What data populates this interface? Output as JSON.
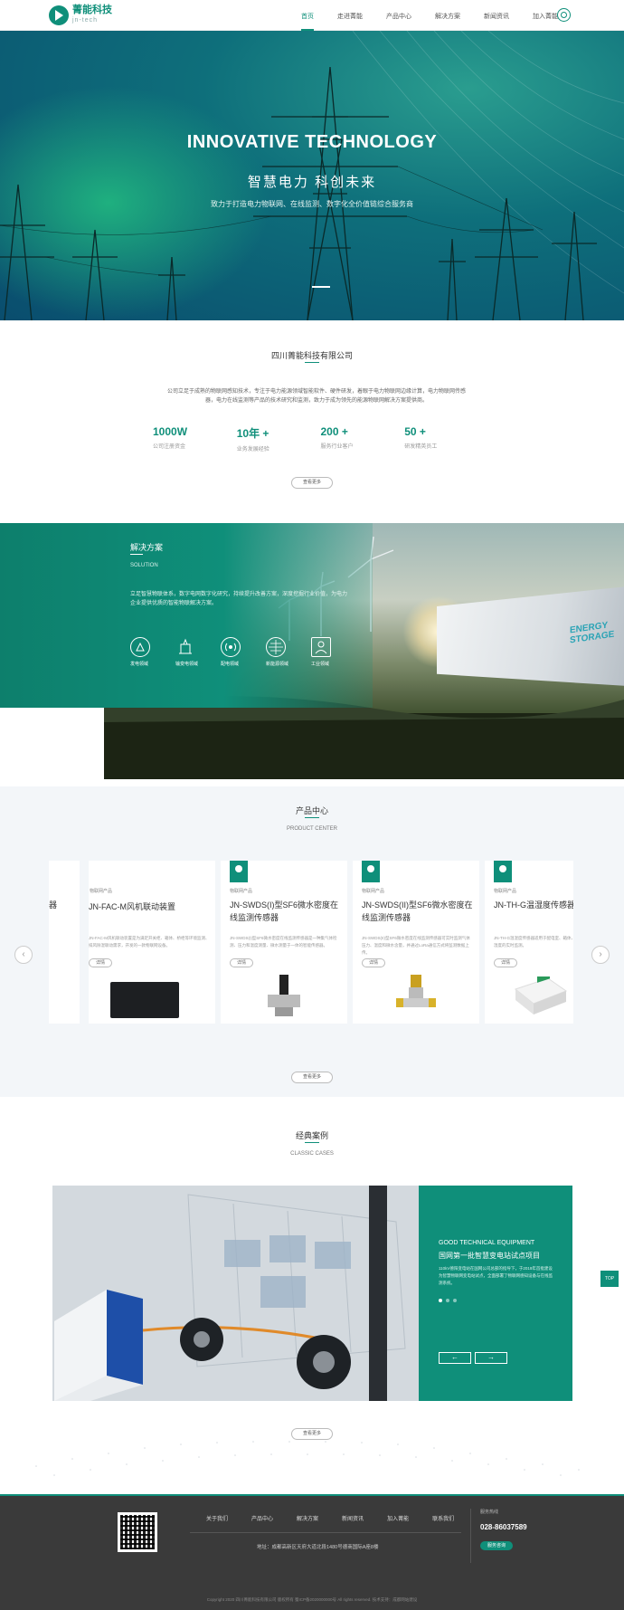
{
  "header": {
    "logo_text": "菁能科技",
    "logo_sub": "jn-tech",
    "nav": [
      "首页",
      "走进菁能",
      "产品中心",
      "解决方案",
      "新闻资讯",
      "加入菁能"
    ],
    "active_index": 0
  },
  "banner": {
    "title": "INNOVATIVE TECHNOLOGY",
    "subtitle": "智慧电力 科创未来",
    "desc": "致力于打造电力物联网、在线监测、数字化全价值链综合服务商"
  },
  "about": {
    "title": "四川菁能科技有限公司",
    "text": "公司立足于成熟的物联网感知技术，专注于电力能源领域智能软件、硬件研发，着眼于电力物联网边缘计算，电力物联网传感器，电力在线监测等产品的技术研究和监测，致力于成为领先的能源物联网解决方案提供商。",
    "stats": [
      {
        "value": "1000W",
        "label": "公司注册资金"
      },
      {
        "value": "10年 +",
        "label": "业务发展经验"
      },
      {
        "value": "200 +",
        "label": "服务行业客户"
      },
      {
        "value": "50 +",
        "label": "研发精英员工"
      }
    ],
    "more_label": "查看更多"
  },
  "solution": {
    "title": "解决方案",
    "subtitle": "SOLUTION",
    "desc": "立足智慧物联体系，数字电网数字化研究，持续提升改善方案，深度挖掘行业价值，为电力企业提供优质的智能物联解决方案。",
    "icons": [
      {
        "name": "power-plant-icon",
        "label": "发电领域"
      },
      {
        "name": "substation-icon",
        "label": "输变电领域"
      },
      {
        "name": "signal-icon",
        "label": "配电领域"
      },
      {
        "name": "globe-icon",
        "label": "新能源领域"
      },
      {
        "name": "worker-icon",
        "label": "工业领域"
      }
    ],
    "energy_label_1": "ENERGY",
    "energy_label_2": "STORAGE"
  },
  "products": {
    "title": "产品中心",
    "subtitle": "PRODUCT CENTER",
    "cards": [
      {
        "category": "",
        "name": "器",
        "desc": "",
        "btn": ""
      },
      {
        "category": "物联网产品",
        "name": "JN-FAC-M风机联动装置",
        "desc": "JN-FAC-M风机联动装置是为满足开关柜、箱体、桥柜等环境监测、排风除湿联动需求，开发的一款物联网设备。",
        "btn": "详情"
      },
      {
        "category": "物联网产品",
        "name": "JN-SWDS(I)型SF6微水密度在线监测传感器",
        "desc": "JN-SWDS(I)型SF6微水密度在线监测传感器是一种集气体检测、压力和温度测量、微水测量于一体的智能传感器。",
        "btn": "详情"
      },
      {
        "category": "物联网产品",
        "name": "JN-SWDS(II)型SF6微水密度在线监测传感器",
        "desc": "JN-SWDS(II)型SF6微水密度在线监测传感器可实时监测气体压力、温度和微水含量，并通过LoRa通信方式将监测数据上传。",
        "btn": "详情"
      },
      {
        "category": "物联网产品",
        "name": "JN-TH-G温湿度传感器",
        "desc": "JN-TH-G温湿度传感器适用于配电室、箱体、柜体等环境中温湿度的实时监测。",
        "btn": "详情"
      }
    ],
    "prev": "‹",
    "next": "›",
    "more_label": "查看更多"
  },
  "cases": {
    "title": "经典案例",
    "subtitle": "CLASSIC CASES",
    "case_en": "GOOD TECHNICAL EQUIPMENT",
    "case_cn": "国网第一批智慧变电站试点项目",
    "case_desc": "110kV德阳变电站在国网公司总部的指导下，于2019年首批建设为智慧物联网变电站试点，全面部署了物联网感知设备与在线监测系统。",
    "prev": "←",
    "next": "→",
    "more_label": "查看更多"
  },
  "side": {
    "top_label": "TOP"
  },
  "footer": {
    "nav": [
      "关于我们",
      "产品中心",
      "解决方案",
      "新闻资讯",
      "加入菁能",
      "联系我们"
    ],
    "address": "地址：成都高新区天府大道北段1480号德商国际A座8楼",
    "hotline_label": "服务热线",
    "phone": "028-86037589",
    "contact_btn": "服务咨询",
    "copyright": "Copyright 2020 四川菁能科技有限公司 版权所有  蜀ICP备2020000000号 All rights reserved.  技术支持：成都网站建设"
  },
  "colors": {
    "brand": "#0f8f7a",
    "footer_bg": "#3a3a3a"
  }
}
